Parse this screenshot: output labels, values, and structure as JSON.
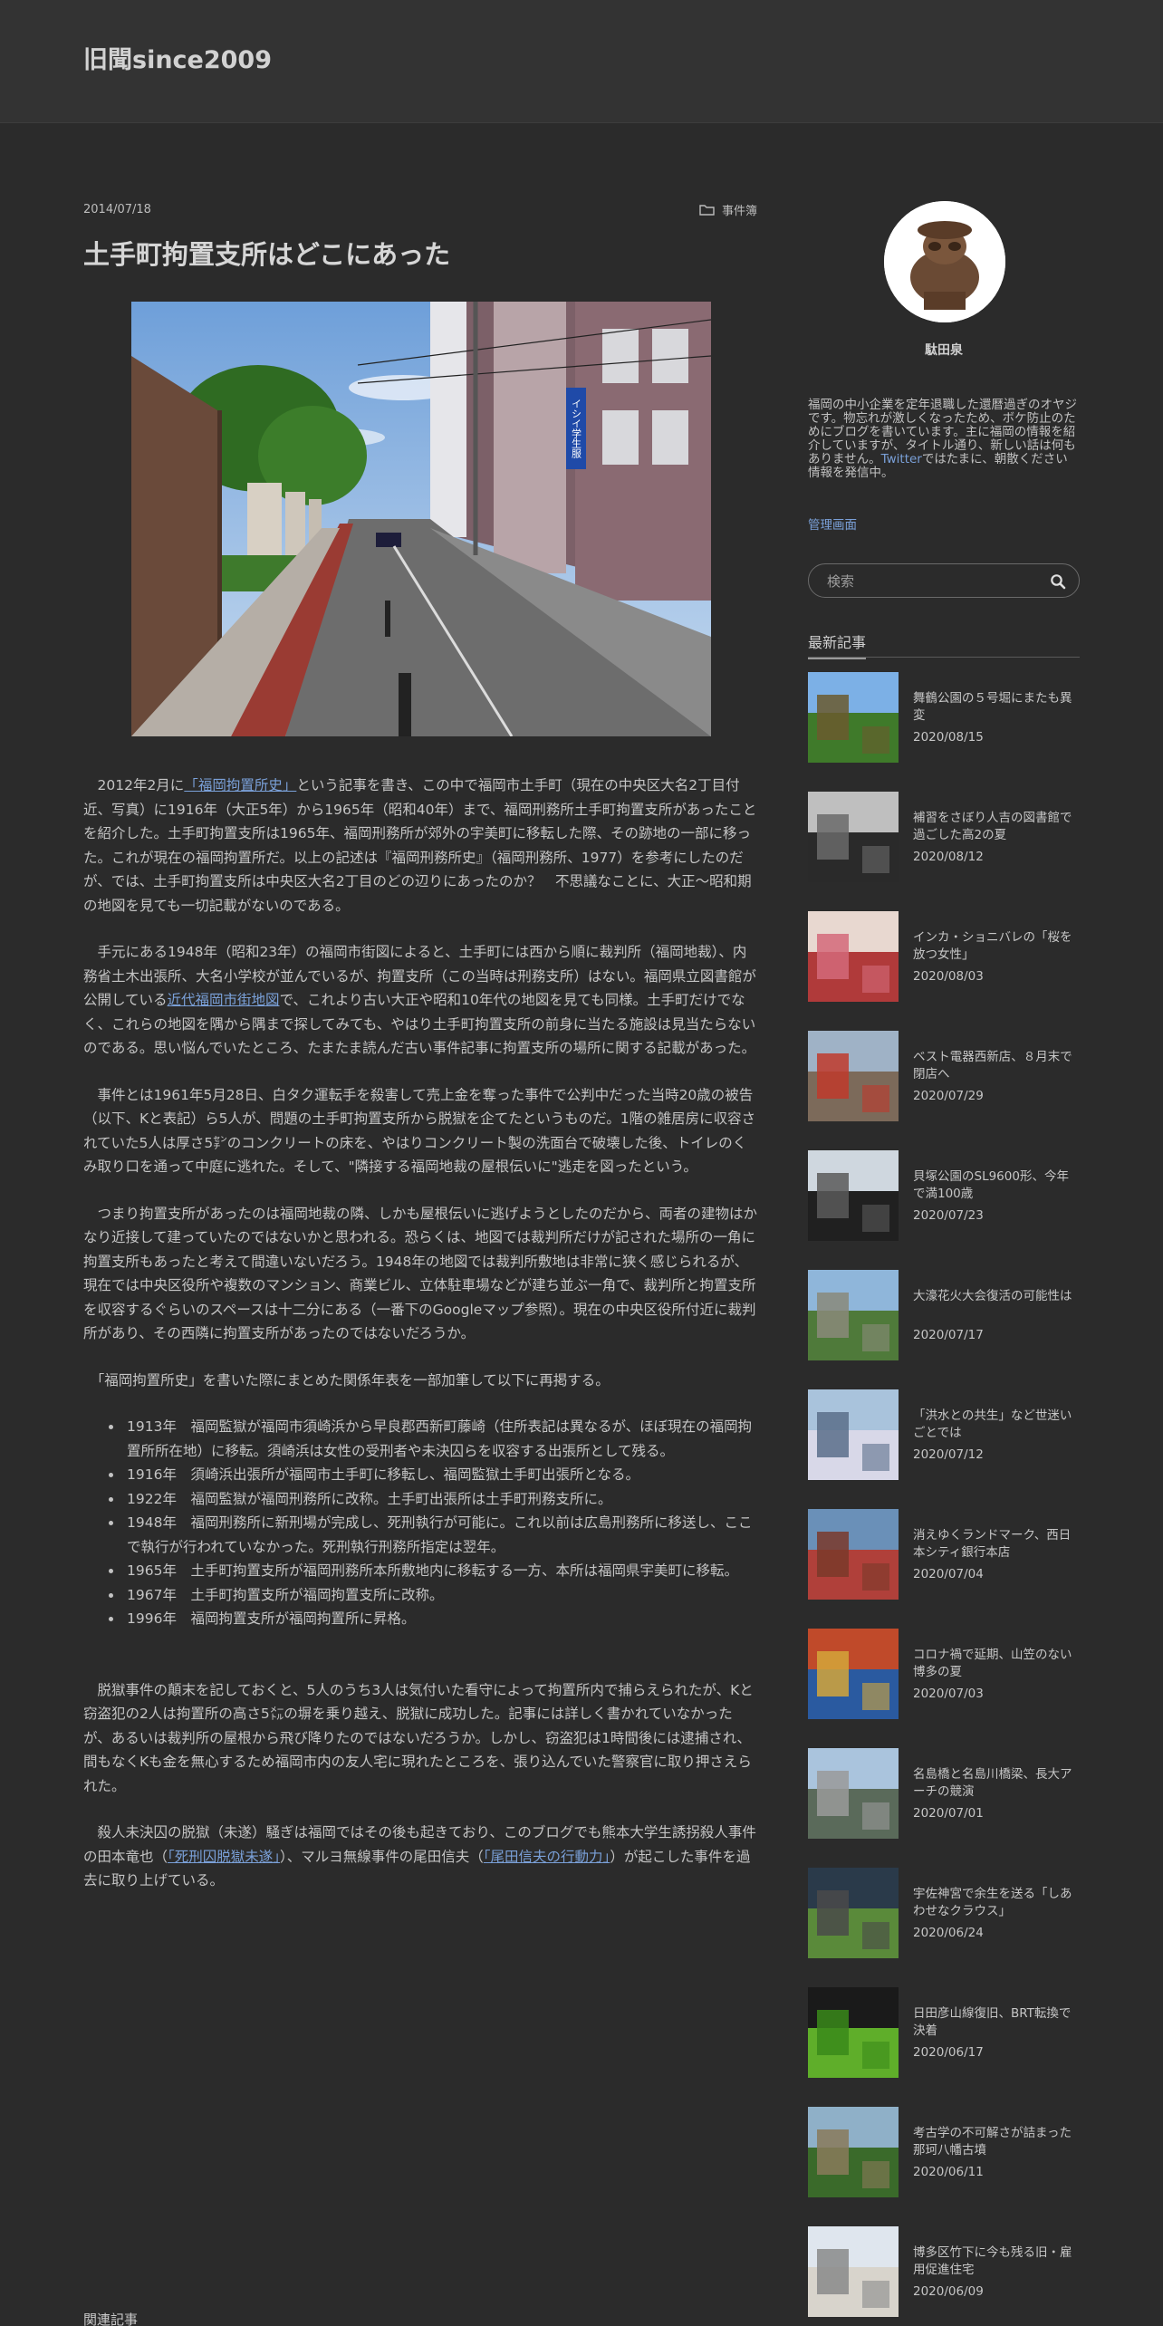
{
  "site": {
    "title": "旧聞since2009"
  },
  "post": {
    "date": "2014/07/18",
    "category": "事件簿",
    "title": "土手町拘置支所はどこにあった",
    "image_sign": "イシイ学生服",
    "paragraphs": [
      [
        {
          "t": "　2012年2月に"
        },
        {
          "t": "「福岡拘置所史」",
          "link": true
        },
        {
          "t": "という記事を書き、この中で福岡市土手町（現在の中央区大名2丁目付近、写真）に1916年（大正5年）から1965年（昭和40年）まで、福岡刑務所土手町拘置支所があったことを紹介した。土手町拘置支所は1965年、福岡刑務所が郊外の宇美町に移転した際、その跡地の一部に移った。これが現在の福岡拘置所だ。以上の記述は『福岡刑務所史』（福岡刑務所、1977）を参考にしたのだが、では、土手町拘置支所は中央区大名2丁目のどの辺りにあったのか？　不思議なことに、大正～昭和期の地図を見ても一切記載がないのである。"
        }
      ],
      [
        {
          "t": "　手元にある1948年（昭和23年）の福岡市街図によると、土手町には西から順に裁判所（福岡地裁）、内務省土木出張所、大名小学校が並んでいるが、拘置支所（この当時は刑務支所）はない。福岡県立図書館が公開している"
        },
        {
          "t": "近代福岡市街地図",
          "link": true
        },
        {
          "t": "で、これより古い大正や昭和10年代の地図を見ても同様。土手町だけでなく、これらの地図を隅から隅まで探してみても、やはり土手町拘置支所の前身に当たる施設は見当たらないのである。思い悩んでいたところ、たまたま読んだ古い事件記事に拘置支所の場所に関する記載があった。"
        }
      ],
      [
        {
          "t": "　事件とは1961年5月28日、白タク運転手を殺害して売上金を奪った事件で公判中だった当時20歳の被告（以下、Kと表記）ら5人が、問題の土手町拘置支所から脱獄を企てたというものだ。1階の雑居房に収容されていた5人は厚さ5㌢のコンクリートの床を、やはりコンクリート製の洗面台で破壊した後、トイレのくみ取り口を通って中庭に逃れた。そして、\"隣接する福岡地裁の屋根伝いに\"逃走を図ったという。"
        }
      ],
      [
        {
          "t": "　つまり拘置支所があったのは福岡地裁の隣、しかも屋根伝いに逃げようとしたのだから、両者の建物はかなり近接して建っていたのではないかと思われる。恐らくは、地図では裁判所だけが記された場所の一角に拘置支所もあったと考えて間違いないだろう。1948年の地図では裁判所敷地は非常に狭く感じられるが、現在では中央区役所や複数のマンション、商業ビル、立体駐車場などが建ち並ぶ一角で、裁判所と拘置支所を収容するぐらいのスペースは十二分にある（一番下のGoogleマップ参照）。現在の中央区役所付近に裁判所があり、その西隣に拘置支所があったのではないだろうか。"
        }
      ],
      [
        {
          "t": "　「福岡拘置所史」を書いた際にまとめた関係年表を一部加筆して以下に再掲する。"
        }
      ]
    ],
    "timeline": [
      "1913年　福岡監獄が福岡市須崎浜から早良郡西新町藤崎（住所表記は異なるが、ほぼ現在の福岡拘置所所在地）に移転。須崎浜は女性の受刑者や未決囚らを収容する出張所として残る。",
      "1916年　須崎浜出張所が福岡市土手町に移転し、福岡監獄土手町出張所となる。",
      "1922年　福岡監獄が福岡刑務所に改称。土手町出張所は土手町刑務支所に。",
      "1948年　福岡刑務所に新刑場が完成し、死刑執行が可能に。これ以前は広島刑務所に移送し、ここで執行が行われていなかった。死刑執行刑務所指定は翌年。",
      "1965年　土手町拘置支所が福岡刑務所本所敷地内に移転する一方、本所は福岡県宇美町に移転。",
      "1967年　土手町拘置支所が福岡拘置支所に改称。",
      "1996年　福岡拘置支所が福岡拘置所に昇格。"
    ],
    "paragraphs_after": [
      [
        {
          "t": "　脱獄事件の顛末を記しておくと、5人のうち3人は気付いた看守によって拘置所内で捕らえられたが、Kと窃盗犯の2人は拘置所の高さ5㍍の塀を乗り越え、脱獄に成功した。記事には詳しく書かれていなかったが、あるいは裁判所の屋根から飛び降りたのではないだろうか。しかし、窃盗犯は1時間後には逮捕され、間もなくKも金を無心するため福岡市内の友人宅に現れたところを、張り込んでいた警察官に取り押さえられた。"
        }
      ],
      [
        {
          "t": "　殺人未決囚の脱獄（未遂）騒ぎは福岡ではその後も起きており、このブログでも熊本大学生誘拐殺人事件の田本竜也（"
        },
        {
          "t": "「死刑囚脱獄未遂」",
          "link": true
        },
        {
          "t": "）、マルヨ無線事件の尾田信夫（"
        },
        {
          "t": "「尾田信夫の行動力」",
          "link": true
        },
        {
          "t": "）が起こした事件を過去に取り上げている。"
        }
      ]
    ],
    "related_label": "関連記事"
  },
  "sidebar": {
    "author": "駄田泉",
    "profile_text": "福岡の中小企業を定年退職した還暦過ぎのオヤジです。物忘れが激しくなったため、ボケ防止のためにブログを書いています。主に福岡の情報を紹介していますが、タイトル通り、新しい話は何もありません。",
    "profile_link": "Twitter",
    "profile_text_after": "ではたまに、朝散ください情報を発信中。",
    "admin_link": "管理画面",
    "search_placeholder": "検索",
    "recent_heading": "最新記事",
    "recent": [
      {
        "title": "舞鶴公園の５号堀にまたも異変",
        "date": "2020/08/15",
        "colors": [
          "#7cb0e6",
          "#3f7a2a",
          "#6b5a2e"
        ]
      },
      {
        "title": "補習をさぼり人吉の図書館で過ごした高2の夏",
        "date": "2020/08/12",
        "colors": [
          "#bfbfbf",
          "#2a2a2a",
          "#6a6a6a"
        ]
      },
      {
        "title": "インカ・ショニバレの「桜を放つ女性」",
        "date": "2020/08/03",
        "colors": [
          "#e8d8d0",
          "#b03a3a",
          "#d46a7a"
        ]
      },
      {
        "title": "ベスト電器西新店、８月末で閉店へ",
        "date": "2020/07/29",
        "colors": [
          "#9fb2c6",
          "#7c6a5a",
          "#c0392b"
        ]
      },
      {
        "title": "貝塚公園のSL9600形、今年で満100歳",
        "date": "2020/07/23",
        "colors": [
          "#cfd7df",
          "#202020",
          "#5a5a5a"
        ]
      },
      {
        "title": "大濠花火大会復活の可能性は",
        "date": "2020/07/17",
        "colors": [
          "#8fb6da",
          "#4f7a3a",
          "#8a8a7a"
        ]
      },
      {
        "title": "「洪水との共生」など世迷いごとでは",
        "date": "2020/07/12",
        "colors": [
          "#a9c3dc",
          "#d8d8e8",
          "#5b6f8a"
        ]
      },
      {
        "title": "消えゆくランドマーク、西日本シティ銀行本店",
        "date": "2020/07/04",
        "colors": [
          "#6a90b8",
          "#b0403a",
          "#7a3a2a"
        ]
      },
      {
        "title": "コロナ禍で延期、山笠のない博多の夏",
        "date": "2020/07/03",
        "colors": [
          "#c04a2a",
          "#2a5aa0",
          "#d4a63a"
        ]
      },
      {
        "title": "名島橋と名島川橋梁、長大アーチの競演",
        "date": "2020/07/01",
        "colors": [
          "#aac4dd",
          "#5a6a5a",
          "#9a9a9a"
        ]
      },
      {
        "title": "宇佐神宮で余生を送る「しあわせなクラウス」",
        "date": "2020/06/24",
        "colors": [
          "#2a3a4a",
          "#5a8a3a",
          "#4a4a4a"
        ]
      },
      {
        "title": "日田彦山線復旧、BRT転換で決着",
        "date": "2020/06/17",
        "colors": [
          "#1a1a1a",
          "#5fae2a",
          "#3a8a1a"
        ]
      },
      {
        "title": "考古学の不可解さが詰まった那珂八幡古墳",
        "date": "2020/06/11",
        "colors": [
          "#8fb0c8",
          "#3a6a2a",
          "#8a7a5a"
        ]
      },
      {
        "title": "博多区竹下に今も残る旧・雇用促進住宅",
        "date": "2020/06/09",
        "colors": [
          "#dfe6ee",
          "#d8d4cc",
          "#8a8a8a"
        ]
      }
    ]
  }
}
